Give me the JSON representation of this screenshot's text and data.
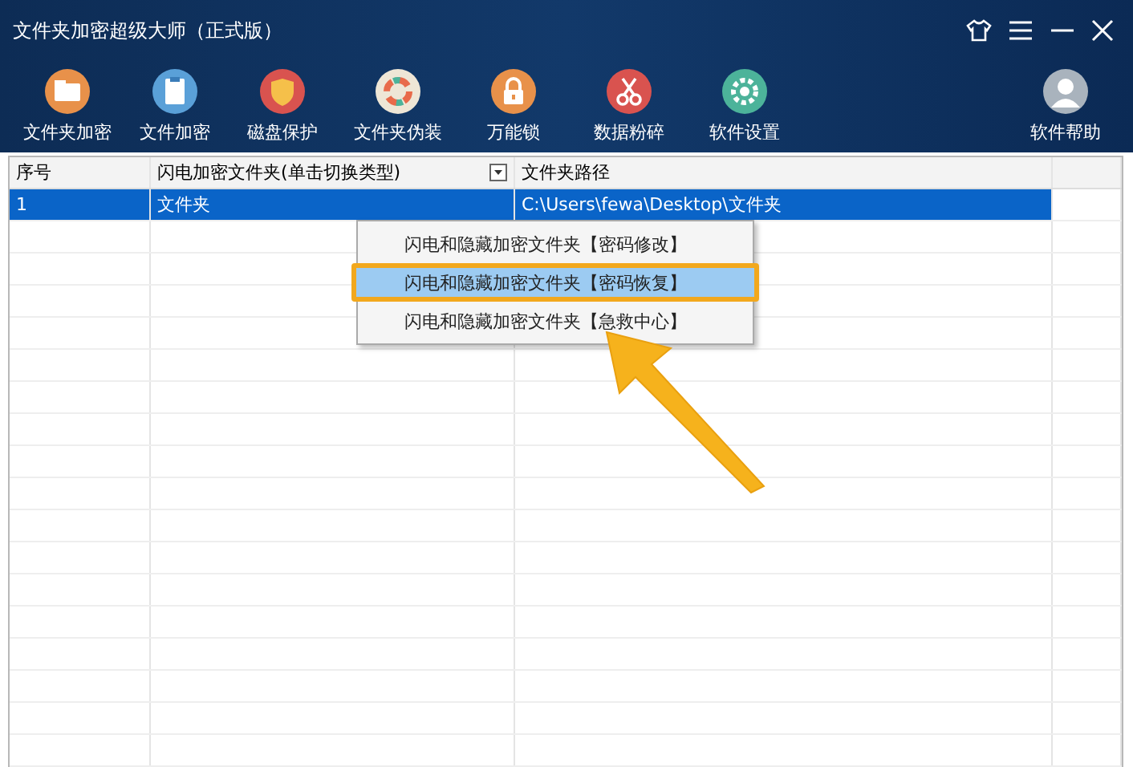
{
  "window": {
    "title": "文件夹加密超级大师（正式版）"
  },
  "toolbar": [
    {
      "label": "文件夹加密",
      "kind": "folder"
    },
    {
      "label": "文件加密",
      "kind": "file"
    },
    {
      "label": "磁盘保护",
      "kind": "shield"
    },
    {
      "label": "文件夹伪装",
      "kind": "disguise"
    },
    {
      "label": "万能锁",
      "kind": "lock"
    },
    {
      "label": "数据粉碎",
      "kind": "scissors"
    },
    {
      "label": "软件设置",
      "kind": "gear"
    },
    {
      "label": "软件帮助",
      "kind": "user"
    }
  ],
  "table": {
    "columns": [
      {
        "label": "序号"
      },
      {
        "label": "闪电加密文件夹(单击切换类型)",
        "dropdown": true
      },
      {
        "label": "文件夹路径"
      }
    ],
    "rows": [
      {
        "cells": [
          "1",
          "文件夹",
          "C:\\Users\\fewa\\Desktop\\文件夹"
        ],
        "selected": true
      }
    ]
  },
  "context_menu": {
    "items": [
      {
        "label": "闪电和隐藏加密文件夹【密码修改】",
        "selected": false
      },
      {
        "label": "闪电和隐藏加密文件夹【密码恢复】",
        "selected": true
      },
      {
        "label": "闪电和隐藏加密文件夹【急救中心】",
        "selected": false
      }
    ]
  }
}
